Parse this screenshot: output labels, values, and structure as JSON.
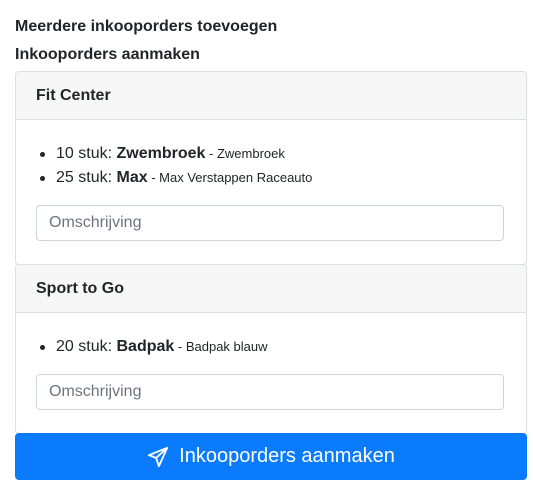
{
  "page": {
    "title": "Meerdere inkooporders toevoegen",
    "subtitle": "Inkooporders aanmaken"
  },
  "suppliers": [
    {
      "name": "Fit Center",
      "items": [
        {
          "qty": "10 stuk:",
          "product": "Zwembroek",
          "separator": " - ",
          "description": "Zwembroek"
        },
        {
          "qty": "25 stuk:",
          "product": "Max",
          "separator": " - ",
          "description": "Max Verstappen Raceauto"
        }
      ],
      "description_placeholder": "Omschrijving"
    },
    {
      "name": "Sport to Go",
      "items": [
        {
          "qty": "20 stuk:",
          "product": "Badpak",
          "separator": " - ",
          "description": "Badpak blauw"
        }
      ],
      "description_placeholder": "Omschrijving"
    }
  ],
  "submit": {
    "label": "Inkooporders aanmaken",
    "icon": "paper-plane-icon"
  },
  "colors": {
    "primary": "#0b7bfe",
    "card_header_bg": "#f7f7f7",
    "border": "#dcdfe3"
  }
}
